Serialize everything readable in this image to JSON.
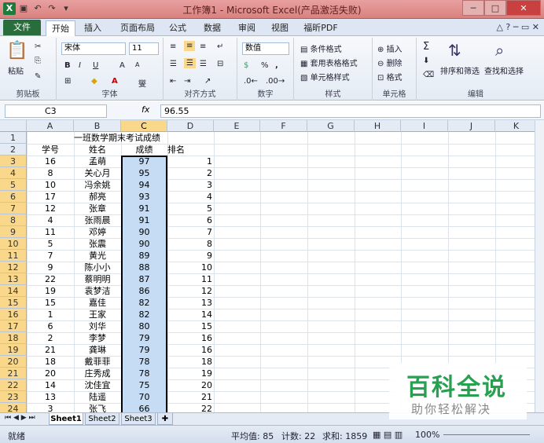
{
  "window": {
    "title": "工作簿1 - Microsoft Excel(产品激活失败)"
  },
  "qat": {
    "icons": [
      "excel-logo",
      "save-icon",
      "undo-icon",
      "redo-icon",
      "customize-icon"
    ]
  },
  "tabs": [
    "文件",
    "开始",
    "插入",
    "页面布局",
    "公式",
    "数据",
    "审阅",
    "视图",
    "福昕PDF"
  ],
  "ribbon": {
    "clipboard": {
      "paste": "粘贴",
      "label": "剪贴板"
    },
    "font": {
      "name": "宋体",
      "size": "11",
      "label": "字体",
      "bold": "B",
      "italic": "I",
      "underline": "U",
      "grow": "A",
      "shrink": "A",
      "wen": "燮"
    },
    "alignment": {
      "label": "对齐方式"
    },
    "number": {
      "format": "数值",
      "percent": "%",
      "comma": ",",
      "label": "数字"
    },
    "styles": {
      "cond": "条件格式",
      "table": "套用表格格式",
      "cell": "单元格样式",
      "label": "样式"
    },
    "cells": {
      "insert": "插入",
      "delete": "删除",
      "format": "格式",
      "label": "单元格"
    },
    "editing": {
      "sum": "Σ",
      "sort": "排序和筛选",
      "find": "查找和选择",
      "label": "编辑"
    }
  },
  "formula": {
    "name_box": "C3",
    "fx": "fx",
    "content": "96.55"
  },
  "columns": [
    "A",
    "B",
    "C",
    "D",
    "E",
    "F",
    "G",
    "H",
    "I",
    "J",
    "K"
  ],
  "sheet": {
    "title": "一班数学期末考试成绩",
    "headers": [
      "学号",
      "姓名",
      "成绩",
      "排名"
    ],
    "rows": [
      [
        "16",
        "孟萌",
        "97",
        "1"
      ],
      [
        "8",
        "关心月",
        "95",
        "2"
      ],
      [
        "10",
        "冯余姚",
        "94",
        "3"
      ],
      [
        "17",
        "郝亮",
        "93",
        "4"
      ],
      [
        "12",
        "张章",
        "91",
        "5"
      ],
      [
        "4",
        "张雨晨",
        "91",
        "6"
      ],
      [
        "11",
        "邓婷",
        "90",
        "7"
      ],
      [
        "5",
        "张震",
        "90",
        "8"
      ],
      [
        "7",
        "黄光",
        "89",
        "9"
      ],
      [
        "9",
        "陈小小",
        "88",
        "10"
      ],
      [
        "22",
        "蔡明明",
        "87",
        "11"
      ],
      [
        "19",
        "袁梦洁",
        "86",
        "12"
      ],
      [
        "15",
        "嘉佳",
        "82",
        "13"
      ],
      [
        "1",
        "王家",
        "82",
        "14"
      ],
      [
        "6",
        "刘华",
        "80",
        "15"
      ],
      [
        "2",
        "李梦",
        "79",
        "16"
      ],
      [
        "21",
        "龚琳",
        "79",
        "16"
      ],
      [
        "18",
        "戴菲菲",
        "78",
        "18"
      ],
      [
        "20",
        "庄秀成",
        "78",
        "19"
      ],
      [
        "14",
        "沈佳宜",
        "75",
        "20"
      ],
      [
        "13",
        "陆遥",
        "70",
        "21"
      ],
      [
        "3",
        "张飞",
        "66",
        "22"
      ]
    ]
  },
  "sheets": [
    "Sheet1",
    "Sheet2",
    "Sheet3"
  ],
  "status": {
    "ready": "就绪",
    "average": "平均值: 85",
    "count": "计数: 22",
    "sum": "求和: 1859",
    "zoom": "100%"
  },
  "watermark": {
    "line1": "百科全说",
    "line2": "助你轻松解决"
  },
  "colors": {
    "selection": "#c5dcf4",
    "header_selected": "#f9d88b",
    "ribbon_bg": "#e4ebf4"
  }
}
